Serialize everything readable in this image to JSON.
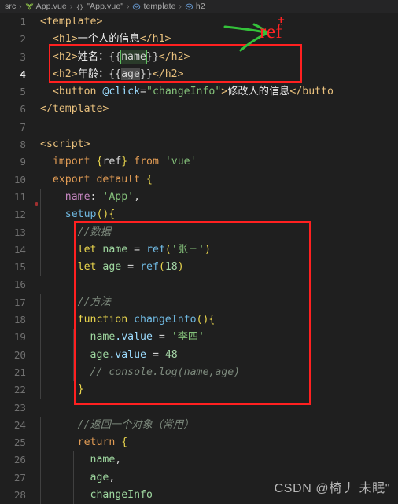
{
  "breadcrumb": {
    "items": [
      {
        "label": "src",
        "icon": "none"
      },
      {
        "label": "App.vue",
        "icon": "vue-icon"
      },
      {
        "label": "\"App.vue\"",
        "icon": "braces-icon"
      },
      {
        "label": "template",
        "icon": "symbol-cube-icon"
      },
      {
        "label": "h2",
        "icon": "symbol-cube-icon"
      }
    ],
    "separator": "›"
  },
  "editor": {
    "active_line": 4,
    "lines": [
      {
        "n": "1",
        "text": "<template>"
      },
      {
        "n": "2",
        "text": "  <h1>一个人的信息</h1>"
      },
      {
        "n": "3",
        "text": "  <h2>姓名：{{name}}</h2>"
      },
      {
        "n": "4",
        "text": "  <h2>年龄：{{age}}</h2>"
      },
      {
        "n": "5",
        "text": "  <button @click=\"changeInfo\">修改人的信息</button>"
      },
      {
        "n": "6",
        "text": "</template>"
      },
      {
        "n": "7",
        "text": ""
      },
      {
        "n": "8",
        "text": "<script>"
      },
      {
        "n": "9",
        "text": "  import {ref} from 'vue'"
      },
      {
        "n": "10",
        "text": "  export default {"
      },
      {
        "n": "11",
        "text": "    name: 'App',"
      },
      {
        "n": "12",
        "text": "    setup(){"
      },
      {
        "n": "13",
        "text": "      //数据"
      },
      {
        "n": "14",
        "text": "      let name = ref('张三')"
      },
      {
        "n": "15",
        "text": "      let age = ref(18)"
      },
      {
        "n": "16",
        "text": ""
      },
      {
        "n": "17",
        "text": "      //方法"
      },
      {
        "n": "18",
        "text": "      function changeInfo(){"
      },
      {
        "n": "19",
        "text": "        name.value = '李四'"
      },
      {
        "n": "20",
        "text": "        age.value = 48"
      },
      {
        "n": "21",
        "text": "        // console.log(name,age)"
      },
      {
        "n": "22",
        "text": "      }"
      },
      {
        "n": "23",
        "text": ""
      },
      {
        "n": "24",
        "text": "      //返回一个对象（常用）"
      },
      {
        "n": "25",
        "text": "      return {"
      },
      {
        "n": "26",
        "text": "        name,"
      },
      {
        "n": "27",
        "text": "        age,"
      },
      {
        "n": "28",
        "text": "        changeInfo"
      }
    ],
    "tokens": {
      "l1_tag_open": "<template>",
      "l2_h1_open": "<h1>",
      "l2_h1_text": "一个人的信息",
      "l2_h1_close": "</h1>",
      "l3_h2_open": "<h2>",
      "l3_label": "姓名：",
      "l3_mus_open": "{{",
      "l3_binding": "name",
      "l3_mus_close": "}}",
      "l3_h2_close": "</h2>",
      "l4_h2_open": "<h2>",
      "l4_label": "年龄：",
      "l4_mus_open": "{{",
      "l4_binding": "age",
      "l4_mus_close": "}}",
      "l4_h2_close": "</h2>",
      "l5_btn_open": "<button ",
      "l5_attr": "@click",
      "l5_eq": "=",
      "l5_attr_val": "\"changeInfo\"",
      "l5_gt": ">",
      "l5_btn_text": "修改人的信息",
      "l5_btn_close": "</butto",
      "l6_tag_close": "</template>",
      "l8_script": "<script>",
      "l9_import": "import",
      "l9_brace_open": "{",
      "l9_ref": "ref",
      "l9_brace_close": "}",
      "l9_from": " from ",
      "l9_vue": "'vue'",
      "l10_export": "export default",
      "l10_brace": " {",
      "l11_name": "name",
      "l11_colon": ": ",
      "l11_app": "'App'",
      "l11_comma": ",",
      "l12_setup": "setup",
      "l12_rest": "(){",
      "l13_comment": "//数据",
      "l14_let": "let",
      "l14_var": " name ",
      "l14_eq": "= ",
      "l14_ref": "ref",
      "l14_p1": "(",
      "l14_str": "'张三'",
      "l14_p2": ")",
      "l15_let": "let",
      "l15_var": " age ",
      "l15_eq": "= ",
      "l15_ref": "ref",
      "l15_p1": "(",
      "l15_num": "18",
      "l15_p2": ")",
      "l17_comment": "//方法",
      "l18_function": "function",
      "l18_name": " changeInfo",
      "l18_rest": "(){",
      "l19_var": "name",
      "l19_prop": ".value",
      "l19_eq": " = ",
      "l19_str": "'李四'",
      "l20_var": "age",
      "l20_prop": ".value",
      "l20_eq": " = ",
      "l20_num": "48",
      "l21_comment": "// console.log(name,age)",
      "l22_brace": "}",
      "l24_comment": "//返回一个对象（常用）",
      "l25_return": "return",
      "l25_brace": " {",
      "l26_name": "name",
      "l26_comma": ",",
      "l27_age": "age",
      "l27_comma": ",",
      "l28_changeinfo": "changeInfo"
    }
  },
  "annotations": {
    "ref_label": "ref",
    "plus_label": "+",
    "box1_name": "template-h2-highlight-box",
    "box2_name": "setup-body-highlight-box",
    "arrow_name": "green-arrow"
  },
  "watermark": {
    "text": "CSDN @椅丿 未眠\""
  },
  "colors": {
    "background": "#1f1f1f",
    "breadcrumb_bg": "#252526",
    "annotation_red": "#ff2020",
    "annotation_green": "#34c23a",
    "indent_guide": "#404040",
    "fold_bar": "#3e7a85"
  }
}
